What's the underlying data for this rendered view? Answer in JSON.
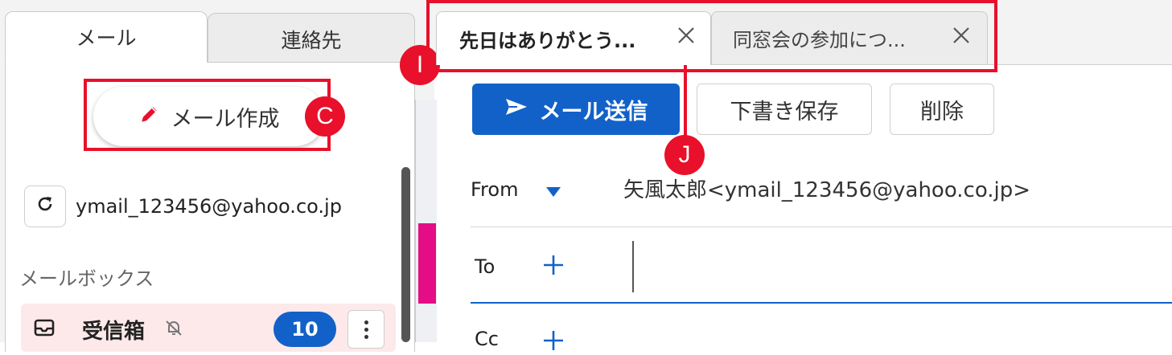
{
  "left_tabs": {
    "mail": "メール",
    "contacts": "連絡先"
  },
  "compose_button": {
    "label": "メール作成",
    "icon": "pencil-icon"
  },
  "account": {
    "email": "ymail_123456@yahoo.co.jp",
    "refresh_icon": "refresh-icon"
  },
  "mailbox": {
    "heading": "メールボックス",
    "inbox": {
      "label": "受信箱",
      "count": "10",
      "icon": "inbox-icon",
      "muted_icon": "bell-off-icon"
    }
  },
  "mail_tabs": [
    {
      "title": "先日はありがとう...",
      "active": true
    },
    {
      "title": "同窓会の参加につ...",
      "active": false
    }
  ],
  "toolbar": {
    "send_label": "メール送信",
    "draft_label": "下書き保存",
    "delete_label": "削除"
  },
  "compose": {
    "from_label": "From",
    "from_value": "矢風太郎<ymail_123456@yahoo.co.jp>",
    "to_label": "To",
    "to_value": "",
    "cc_label": "Cc"
  },
  "annotations": {
    "c": "C",
    "i": "I",
    "j": "J"
  },
  "colors": {
    "accent_blue": "#1261c9",
    "annotation_red": "#e8102a",
    "inbox_bg": "#fde9ea",
    "pink_strip": "#e40d86"
  }
}
